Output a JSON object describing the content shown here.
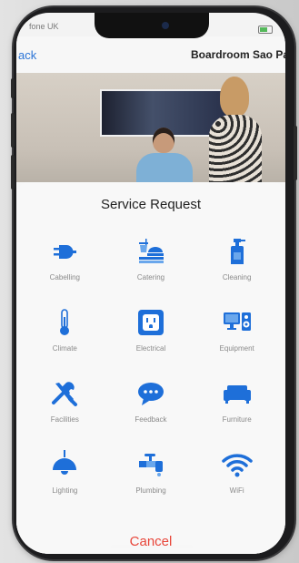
{
  "status": {
    "carrier": "fone UK",
    "battery_color": "#54b85a"
  },
  "navbar": {
    "back_label": "ack",
    "title": "Boardroom Sao Pa"
  },
  "sheet": {
    "title": "Service Request",
    "accent_color": "#1e6fd9",
    "cancel_label": "Cancel",
    "cancel_color": "#e8463a",
    "items": [
      {
        "label": "Cabelling",
        "icon": "plug-icon"
      },
      {
        "label": "Catering",
        "icon": "catering-icon"
      },
      {
        "label": "Cleaning",
        "icon": "spray-bottle-icon"
      },
      {
        "label": "Climate",
        "icon": "thermometer-icon"
      },
      {
        "label": "Electrical",
        "icon": "outlet-icon"
      },
      {
        "label": "Equipment",
        "icon": "monitor-speaker-icon"
      },
      {
        "label": "Facilities",
        "icon": "tools-icon"
      },
      {
        "label": "Feedback",
        "icon": "chat-bubble-icon"
      },
      {
        "label": "Furniture",
        "icon": "sofa-icon"
      },
      {
        "label": "Lighting",
        "icon": "lamp-icon"
      },
      {
        "label": "Plumbing",
        "icon": "faucet-icon"
      },
      {
        "label": "WiFi",
        "icon": "wifi-icon"
      }
    ]
  }
}
